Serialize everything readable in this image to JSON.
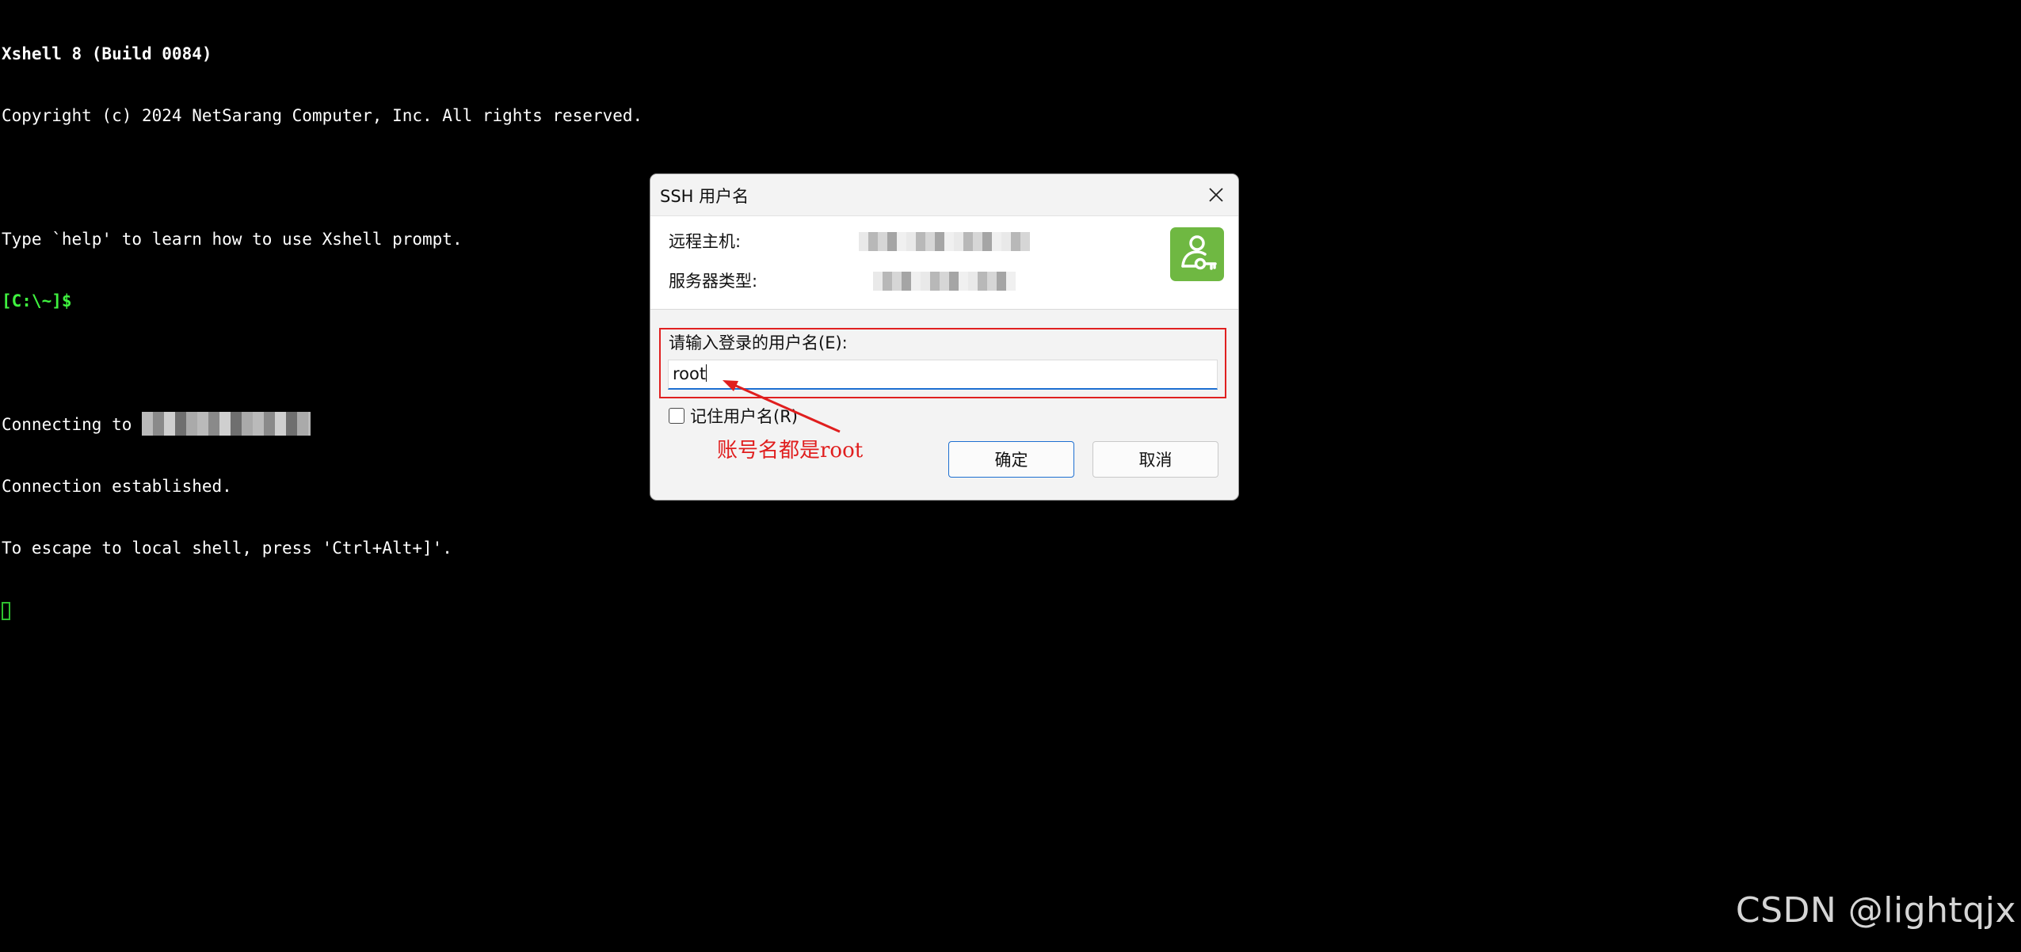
{
  "terminal": {
    "banner_title": "Xshell 8 (Build 0084)",
    "copyright": "Copyright (c) 2024 NetSarang Computer, Inc. All rights reserved.",
    "help_hint": "Type `help' to learn how to use Xshell prompt.",
    "prompt": "[C:\\~]$",
    "connecting_prefix": "Connecting to ",
    "connection_established": "Connection established.",
    "escape_hint": "To escape to local shell, press 'Ctrl+Alt+]'.",
    "colors": {
      "text": "#ffffff",
      "prompt": "#3ff23f",
      "cursor": "#2fbf2f"
    }
  },
  "dialog": {
    "title": "SSH 用户名",
    "remote_host_label": "远程主机:",
    "server_type_label": "服务器类型:",
    "username_label": "请输入登录的用户名(E):",
    "username_value": "root",
    "remember_label": "记住用户名(R)",
    "remember_checked": false,
    "ok_label": "确定",
    "cancel_label": "取消",
    "avatar_icon": "user-key-icon",
    "colors": {
      "avatar_bg": "#6fb842",
      "focus": "#1d6fd1",
      "highlight": "#e02020"
    }
  },
  "annotation": {
    "text": "账号名都是root",
    "color": "#e01e1e"
  },
  "watermark": "CSDN @lightqjx"
}
